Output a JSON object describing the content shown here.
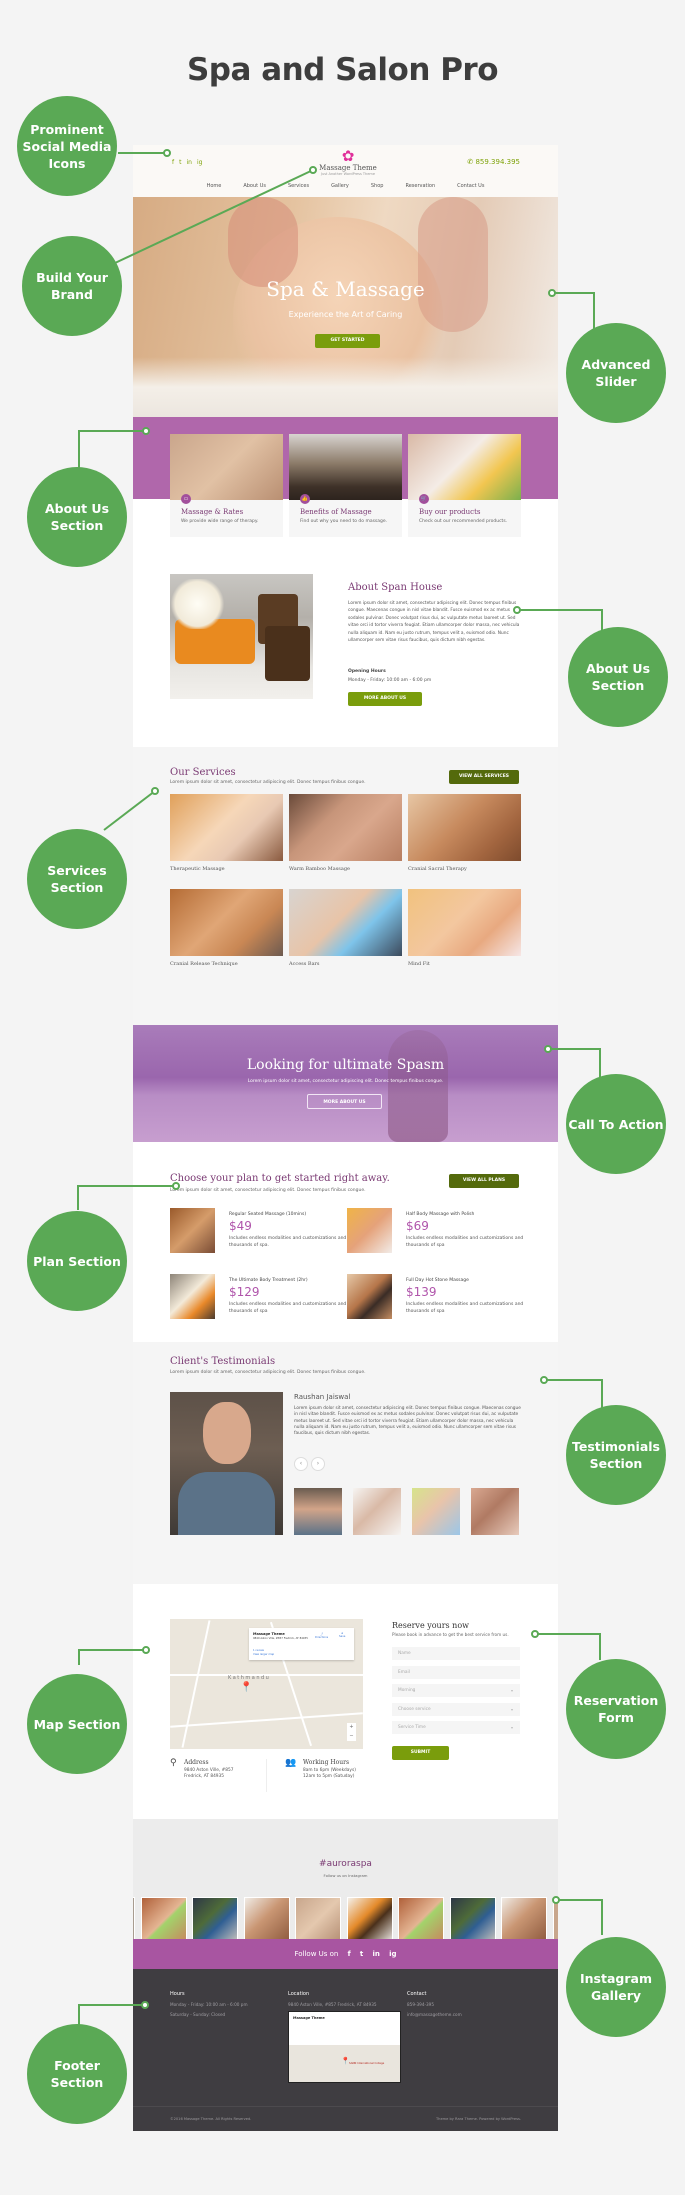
{
  "title": "Spa and Salon Pro",
  "colors": {
    "accent_green": "#7a9d0c",
    "dark_green": "#546a0c",
    "purple": "#b067ab",
    "heading_purple": "#7a3a73",
    "callout_green": "#5aa955",
    "footer_bg": "#3f3d41"
  },
  "callouts": {
    "social": "Prominent Social Media Icons",
    "brand": "Build Your Brand",
    "slider": "Advanced Slider",
    "about_left": "About Us Section",
    "about_right": "About Us Section",
    "services": "Services Section",
    "cta": "Call To Action",
    "plan": "Plan Section",
    "testimonials": "Testimonials Section",
    "map": "Map Section",
    "reservation": "Reservation Form",
    "instagram": "Instagram Gallery",
    "footer": "Footer Section"
  },
  "header": {
    "social_icons": [
      "f",
      "t",
      "in",
      "ig"
    ],
    "logo_mark": "✿",
    "logo_name": "Massage Theme",
    "logo_tagline": "Just Another WordPress Theme",
    "phone_icon": "✆",
    "phone": "859.394.395",
    "nav": [
      "Home",
      "About Us",
      "Services",
      "Gallery",
      "Shop",
      "Reservation",
      "Contact Us"
    ]
  },
  "hero": {
    "title": "Spa & Massage",
    "subtitle": "Experience the Art of Caring",
    "button": "GET STARTED"
  },
  "features": [
    {
      "title": "Massage & Rates",
      "desc": "We provide wide range of therapy.",
      "icon": "▭"
    },
    {
      "title": "Benefits of Massage",
      "desc": "Find out why you need to do massage.",
      "icon": "👍"
    },
    {
      "title": "Buy our products",
      "desc": "Check out our recommended products.",
      "icon": "🛒"
    }
  ],
  "about": {
    "title": "About Span House",
    "text": "Lorem ipsum dolor sit amet, consectetur adipiscing elit. Donec tempus finibus congue. Maecenas congue in nisl vitae blandit. Fusce euismod ex ac metus sodales pulvinar. Donec volutpat risus dui, ac vulputate metus laoreet ut. Sed vitae orci id tortor viverra feugiat. Etiam ullamcorper dolor massa, nec vehicula nulla aliquam id. Nam eu justo rutrum, tempus velit a, euismod odio. Nunc ullamcorper sem vitae risus faucibus, quis dictum nibh egestas.",
    "hours_label": "Opening Hours",
    "hours": "Monday - Friday: 10:00 am - 6:00 pm",
    "button": "MORE ABOUT US"
  },
  "services": {
    "title": "Our Services",
    "subtitle": "Lorem ipsum dolor sit amet, consectetur adipiscing elit. Donec tempus finibus congue.",
    "button": "VIEW ALL SERVICES",
    "items": [
      "Therapeutic Massage",
      "Warm Bamboo Massage",
      "Cranial Sacral Therapy",
      "Cranial Release Technique",
      "Access Bars",
      "Mind Fit"
    ]
  },
  "cta": {
    "title": "Looking for ultimate Spasm",
    "subtitle": "Lorem ipsum dolor sit amet, consectetur adipiscing elit. Donec tempus finibus congue.",
    "button": "MORE ABOUT US"
  },
  "plans": {
    "title": "Choose your plan to get started right away.",
    "subtitle": "Lorem ipsum dolor sit amet, consectetur adipiscing elit. Donec tempus finibus congue.",
    "button": "VIEW ALL PLANS",
    "items": [
      {
        "name": "Regular Seated Massage (10mins)",
        "price": "$49",
        "desc": "Includes endless modalities and customizations and thousands of spa."
      },
      {
        "name": "Half Body Massage with Polish",
        "price": "$69",
        "desc": "Includes endless modalities and customizations and thousands of spa"
      },
      {
        "name": "The Ultimate Body Treatment (2hr)",
        "price": "$129",
        "desc": "Includes endless modalities and customizations and thousands of spa"
      },
      {
        "name": "Full Day Hot Stone Massage",
        "price": "$139",
        "desc": "Includes endless modalities and customizations and thousands of spa"
      }
    ]
  },
  "testimonials": {
    "title": "Client's Testimonials",
    "subtitle": "Lorem ipsum dolor sit amet, consectetur adipiscing elit. Donec tempus finibus congue.",
    "name": "Raushan Jaiswal",
    "text": "Lorem ipsum dolor sit amet, consectetur adipiscing elit. Donec tempus finibus congue. Maecenas congue in nisl vitae blandit. Fusce euismod ex ac metus sodales pulvinar. Donec volutpat risus dui, ac vulputate metus laoreet ut. Sed vitae orci id tortor viverra feugiat. Etiam ullamcorper dolor massa, nec vehicula nulla aliquam id. Nam eu justo rutrum, tempus velit a, euismod odio. Nunc ullamcorper sem vitae risus faucibus, quis dictum nibh egestas.",
    "prev": "‹",
    "next": "›"
  },
  "reservation": {
    "map": {
      "place": "Massage Theme",
      "address": "9840 Aston Ville, #857 Fredrick, AT 84935",
      "reviews": "1 review",
      "larger": "View larger map",
      "directions": "Directions",
      "save": "Save",
      "city": "Kathmandu",
      "zoom_in": "+",
      "zoom_out": "−"
    },
    "address_title": "Address",
    "address_line1": "9840 Aston Ville, #857",
    "address_line2": "Fredrick, AT 84935",
    "hours_title": "Working Hours",
    "hours_line1": "8am to 6pm (Weekdays)",
    "hours_line2": "12am to 5pm (Satuday)",
    "form_title": "Reserve yours now",
    "form_sub": "Please book in advance to get the best service from us.",
    "name_placeholder": "Name",
    "email_placeholder": "Email",
    "time_of_day": "Morning",
    "service": "Choose service",
    "service_time": "Service Time",
    "submit": "SUBMIT"
  },
  "instagram": {
    "title": "#auroraspa",
    "subtitle": "Follow us on Instagram"
  },
  "follow": {
    "label": "Follow Us on",
    "icons": [
      "f",
      "t",
      "in",
      "ig"
    ]
  },
  "footer": {
    "hours_title": "Hours",
    "hours_line1": "Monday - Friday: 10:00 am - 6:00 pm",
    "hours_line2": "Saturday - Sunday: Closed",
    "location_title": "Location",
    "location_text": "9840 Aston Ville, #857 Fredrick, AT 84935",
    "map_place": "Massage Theme",
    "map_marker": "SANN International College",
    "contact_title": "Contact",
    "phone": "859-394-395",
    "email": "info@massagetheme.com",
    "copyright": "©2016 Massage Theme. All Rights Reserved.",
    "credit": "Theme by Rara Theme. Powered by WordPress."
  }
}
